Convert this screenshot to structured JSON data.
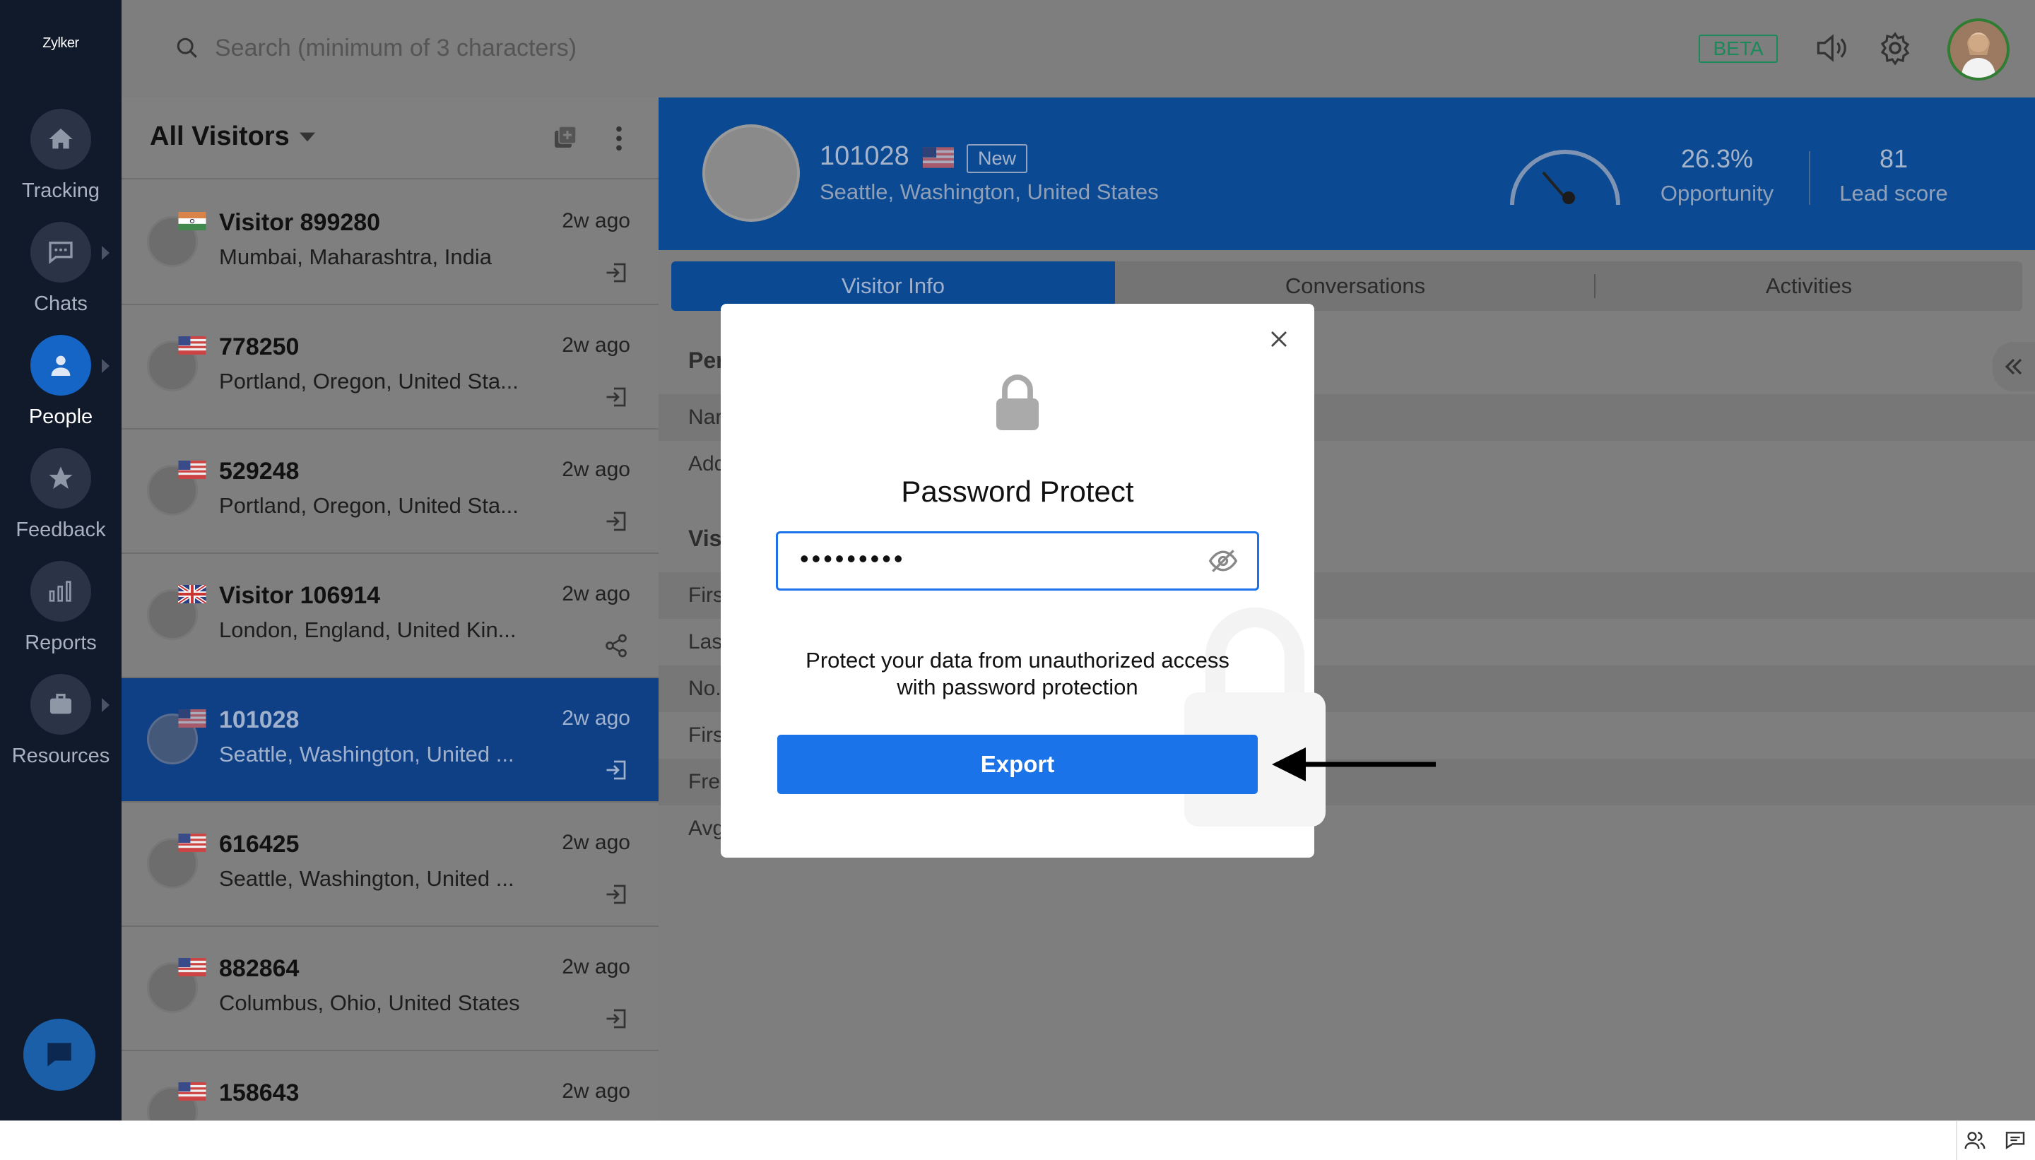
{
  "app": {
    "logo": "Zylker"
  },
  "nav": {
    "items": [
      {
        "label": "Tracking"
      },
      {
        "label": "Chats"
      },
      {
        "label": "People"
      },
      {
        "label": "Feedback"
      },
      {
        "label": "Reports"
      },
      {
        "label": "Resources"
      }
    ]
  },
  "header": {
    "search_placeholder": "Search (minimum of 3 characters)",
    "beta": "BETA"
  },
  "list": {
    "title": "All Visitors",
    "visitors": [
      {
        "name": "Visitor 899280",
        "location": "Mumbai, Maharashtra, India",
        "time": "2w ago"
      },
      {
        "name": "778250",
        "location": "Portland, Oregon, United Sta...",
        "time": "2w ago"
      },
      {
        "name": "529248",
        "location": "Portland, Oregon, United Sta...",
        "time": "2w ago"
      },
      {
        "name": "Visitor 106914",
        "location": "London, England, United Kin...",
        "time": "2w ago"
      },
      {
        "name": "101028",
        "location": "Seattle, Washington, United ...",
        "time": "2w ago"
      },
      {
        "name": "616425",
        "location": "Seattle, Washington, United ...",
        "time": "2w ago"
      },
      {
        "name": "882864",
        "location": "Columbus, Ohio, United States",
        "time": "2w ago"
      },
      {
        "name": "158643",
        "location": "",
        "time": "2w ago"
      }
    ]
  },
  "detail": {
    "name": "101028",
    "badge": "New",
    "location": "Seattle, Washington, United States",
    "opportunity_value": "26.3%",
    "opportunity_label": "Opportunity",
    "lead_value": "81",
    "lead_label": "Lead score",
    "tabs": [
      "Visitor Info",
      "Conversations",
      "Activities"
    ],
    "field_labels": [
      "Per",
      "Nar",
      "Add",
      "Vis",
      "Firs",
      "Las",
      "No.",
      "Firs",
      "Fre",
      "Avg"
    ]
  },
  "modal": {
    "title": "Password Protect",
    "password_value": "•••••••••",
    "description_line1": "Protect your data from unauthorized access",
    "description_line2": "with password protection",
    "export_label": "Export"
  }
}
